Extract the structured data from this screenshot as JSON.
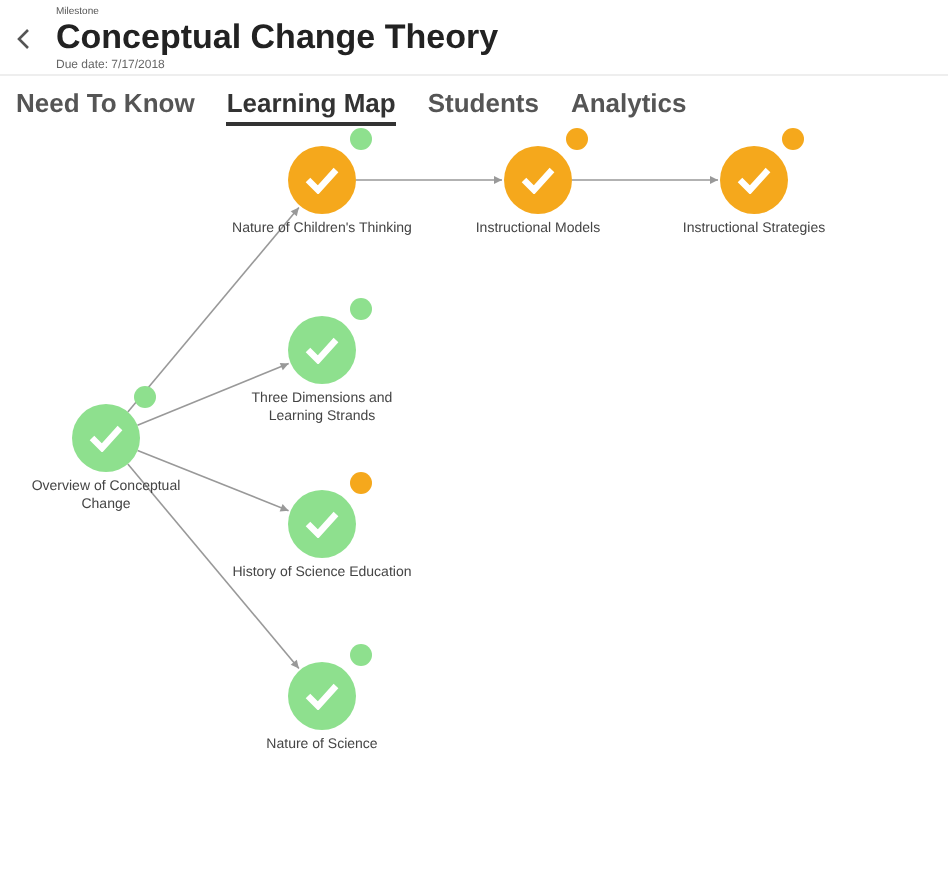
{
  "header": {
    "eyebrow": "Milestone",
    "title": "Conceptual Change Theory",
    "due_date": "Due date: 7/17/2018"
  },
  "tabs": [
    {
      "label": "Need To Know",
      "selected": false
    },
    {
      "label": "Learning Map",
      "selected": true
    },
    {
      "label": "Students",
      "selected": false
    },
    {
      "label": "Analytics",
      "selected": false
    }
  ],
  "map": {
    "nodes": [
      {
        "label": "Overview of Conceptual Change",
        "color": "#8ee08e",
        "badge": {
          "color": "#8ee08e"
        }
      },
      {
        "label": "Nature of Children's Thinking",
        "color": "#f5a81c",
        "badge": {
          "color": "#8ee08e"
        }
      },
      {
        "label": "Instructional Models",
        "color": "#f5a81c",
        "badge": {
          "color": "#f5a81c"
        }
      },
      {
        "label": "Instructional Strategies",
        "color": "#f5a81c",
        "badge": {
          "color": "#f5a81c"
        }
      },
      {
        "label": "Three Dimensions and Learning Strands",
        "color": "#8ee08e",
        "badge": {
          "color": "#8ee08e"
        }
      },
      {
        "label": "History of Science Education",
        "color": "#8ee08e",
        "badge": {
          "color": "#f5a81c"
        }
      },
      {
        "label": "Nature of Science",
        "color": "#8ee08e",
        "badge": {
          "color": "#8ee08e"
        }
      }
    ]
  }
}
